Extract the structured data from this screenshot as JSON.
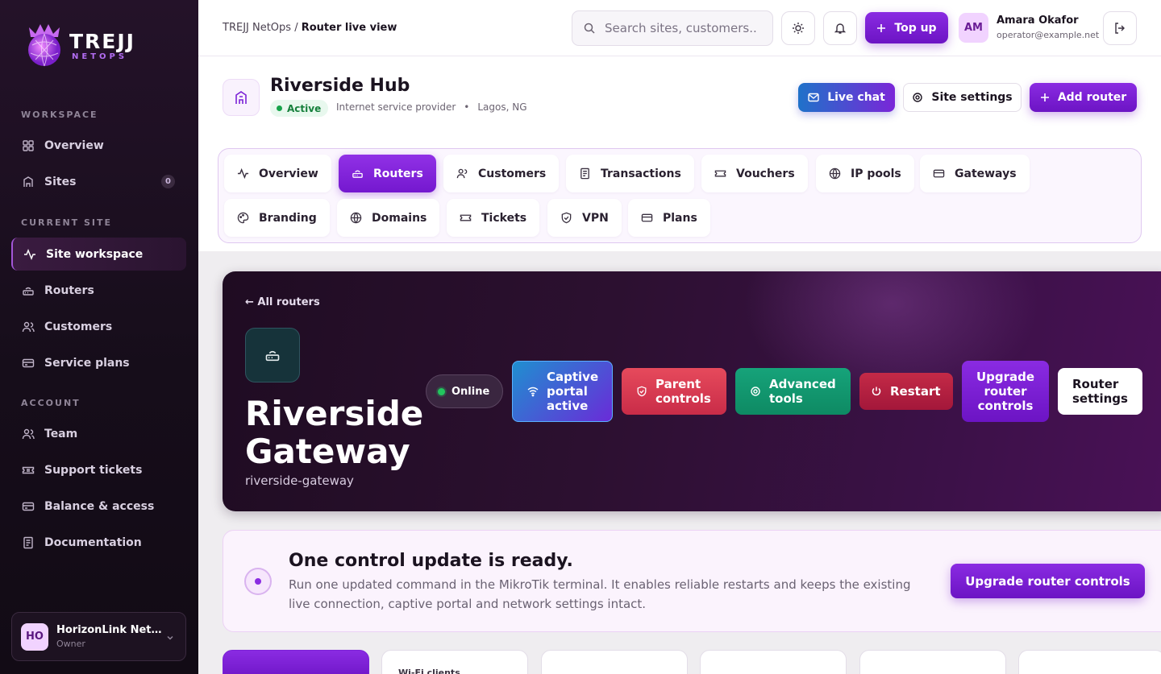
{
  "brand": {
    "title": "TREJJ",
    "subtitle": "NETOPS"
  },
  "sidebar": {
    "workspace_label": "WORKSPACE",
    "current_site_label": "CURRENT SITE",
    "account_label": "ACCOUNT",
    "items": [
      {
        "label": "Overview"
      },
      {
        "label": "Sites",
        "badge": "0"
      },
      {
        "label": "Site workspace"
      },
      {
        "label": "Routers"
      },
      {
        "label": "Customers"
      },
      {
        "label": "Service plans"
      },
      {
        "label": "Team"
      },
      {
        "label": "Support tickets"
      },
      {
        "label": "Balance & access"
      },
      {
        "label": "Documentation"
      }
    ],
    "org": {
      "initials": "HO",
      "name": "HorizonLink Net…",
      "role": "Owner"
    }
  },
  "topbar": {
    "crumb_root": "TREJJ NetOps",
    "crumb_sep": " / ",
    "crumb_current": "Router live view",
    "search_placeholder": "Search sites, customers...",
    "topup_label": "Top up",
    "user": {
      "initials": "AM",
      "name": "Amara Okafor",
      "email": "operator@example.net"
    }
  },
  "site": {
    "name": "Riverside Hub",
    "status": "Active",
    "type": "Internet service provider",
    "sep": "•",
    "location": "Lagos, NG",
    "live_chat": "Live chat",
    "settings": "Site settings",
    "add_router": "Add router"
  },
  "tabs": [
    {
      "label": "Overview"
    },
    {
      "label": "Routers",
      "active": true
    },
    {
      "label": "Customers"
    },
    {
      "label": "Transactions"
    },
    {
      "label": "Vouchers"
    },
    {
      "label": "IP pools"
    },
    {
      "label": "Gateways"
    },
    {
      "label": "Branding"
    },
    {
      "label": "Domains"
    },
    {
      "label": "Tickets"
    },
    {
      "label": "VPN"
    },
    {
      "label": "Plans"
    }
  ],
  "router": {
    "back": "← All routers",
    "title_line1": "Riverside",
    "title_line2": "Gateway",
    "slug": "riverside-gateway",
    "status": "Online",
    "actions": {
      "captive": "Captive portal active",
      "parent": "Parent controls",
      "advanced": "Advanced tools",
      "restart": "Restart",
      "upgrade": "Upgrade router controls",
      "settings": "Router settings"
    }
  },
  "notice": {
    "title": "One control update is ready.",
    "body": "Run one updated command in the MikroTik terminal. It enables reliable restarts and keeps the existing live connection, captive portal and network settings intact.",
    "button": "Upgrade router controls"
  },
  "stats": [
    {
      "label": ""
    },
    {
      "label": "Wi-Fi clients"
    }
  ],
  "colors": {
    "accent": "#7b22d6",
    "success": "#16a34a",
    "sidebar": "#1a0f1e"
  }
}
